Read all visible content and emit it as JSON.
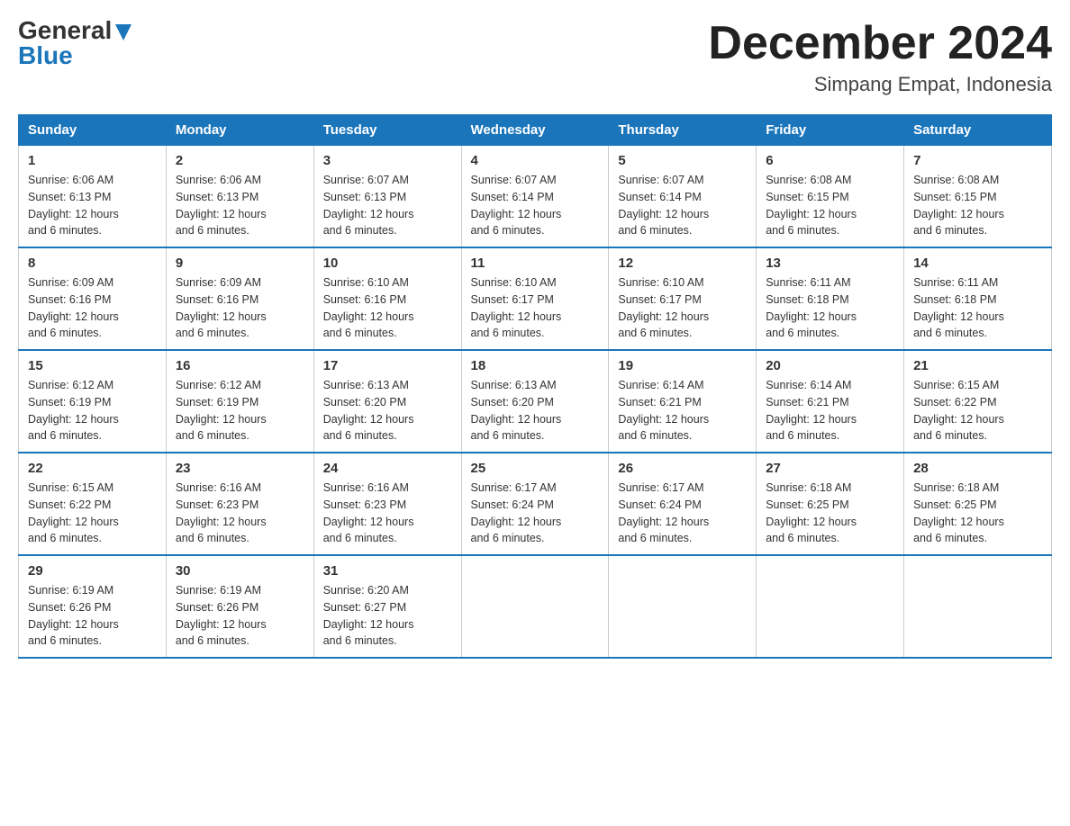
{
  "logo": {
    "general": "General",
    "blue": "Blue"
  },
  "header": {
    "month": "December 2024",
    "location": "Simpang Empat, Indonesia"
  },
  "days_of_week": [
    "Sunday",
    "Monday",
    "Tuesday",
    "Wednesday",
    "Thursday",
    "Friday",
    "Saturday"
  ],
  "weeks": [
    [
      {
        "day": "1",
        "sunrise": "6:06 AM",
        "sunset": "6:13 PM",
        "daylight": "12 hours and 6 minutes."
      },
      {
        "day": "2",
        "sunrise": "6:06 AM",
        "sunset": "6:13 PM",
        "daylight": "12 hours and 6 minutes."
      },
      {
        "day": "3",
        "sunrise": "6:07 AM",
        "sunset": "6:13 PM",
        "daylight": "12 hours and 6 minutes."
      },
      {
        "day": "4",
        "sunrise": "6:07 AM",
        "sunset": "6:14 PM",
        "daylight": "12 hours and 6 minutes."
      },
      {
        "day": "5",
        "sunrise": "6:07 AM",
        "sunset": "6:14 PM",
        "daylight": "12 hours and 6 minutes."
      },
      {
        "day": "6",
        "sunrise": "6:08 AM",
        "sunset": "6:15 PM",
        "daylight": "12 hours and 6 minutes."
      },
      {
        "day": "7",
        "sunrise": "6:08 AM",
        "sunset": "6:15 PM",
        "daylight": "12 hours and 6 minutes."
      }
    ],
    [
      {
        "day": "8",
        "sunrise": "6:09 AM",
        "sunset": "6:16 PM",
        "daylight": "12 hours and 6 minutes."
      },
      {
        "day": "9",
        "sunrise": "6:09 AM",
        "sunset": "6:16 PM",
        "daylight": "12 hours and 6 minutes."
      },
      {
        "day": "10",
        "sunrise": "6:10 AM",
        "sunset": "6:16 PM",
        "daylight": "12 hours and 6 minutes."
      },
      {
        "day": "11",
        "sunrise": "6:10 AM",
        "sunset": "6:17 PM",
        "daylight": "12 hours and 6 minutes."
      },
      {
        "day": "12",
        "sunrise": "6:10 AM",
        "sunset": "6:17 PM",
        "daylight": "12 hours and 6 minutes."
      },
      {
        "day": "13",
        "sunrise": "6:11 AM",
        "sunset": "6:18 PM",
        "daylight": "12 hours and 6 minutes."
      },
      {
        "day": "14",
        "sunrise": "6:11 AM",
        "sunset": "6:18 PM",
        "daylight": "12 hours and 6 minutes."
      }
    ],
    [
      {
        "day": "15",
        "sunrise": "6:12 AM",
        "sunset": "6:19 PM",
        "daylight": "12 hours and 6 minutes."
      },
      {
        "day": "16",
        "sunrise": "6:12 AM",
        "sunset": "6:19 PM",
        "daylight": "12 hours and 6 minutes."
      },
      {
        "day": "17",
        "sunrise": "6:13 AM",
        "sunset": "6:20 PM",
        "daylight": "12 hours and 6 minutes."
      },
      {
        "day": "18",
        "sunrise": "6:13 AM",
        "sunset": "6:20 PM",
        "daylight": "12 hours and 6 minutes."
      },
      {
        "day": "19",
        "sunrise": "6:14 AM",
        "sunset": "6:21 PM",
        "daylight": "12 hours and 6 minutes."
      },
      {
        "day": "20",
        "sunrise": "6:14 AM",
        "sunset": "6:21 PM",
        "daylight": "12 hours and 6 minutes."
      },
      {
        "day": "21",
        "sunrise": "6:15 AM",
        "sunset": "6:22 PM",
        "daylight": "12 hours and 6 minutes."
      }
    ],
    [
      {
        "day": "22",
        "sunrise": "6:15 AM",
        "sunset": "6:22 PM",
        "daylight": "12 hours and 6 minutes."
      },
      {
        "day": "23",
        "sunrise": "6:16 AM",
        "sunset": "6:23 PM",
        "daylight": "12 hours and 6 minutes."
      },
      {
        "day": "24",
        "sunrise": "6:16 AM",
        "sunset": "6:23 PM",
        "daylight": "12 hours and 6 minutes."
      },
      {
        "day": "25",
        "sunrise": "6:17 AM",
        "sunset": "6:24 PM",
        "daylight": "12 hours and 6 minutes."
      },
      {
        "day": "26",
        "sunrise": "6:17 AM",
        "sunset": "6:24 PM",
        "daylight": "12 hours and 6 minutes."
      },
      {
        "day": "27",
        "sunrise": "6:18 AM",
        "sunset": "6:25 PM",
        "daylight": "12 hours and 6 minutes."
      },
      {
        "day": "28",
        "sunrise": "6:18 AM",
        "sunset": "6:25 PM",
        "daylight": "12 hours and 6 minutes."
      }
    ],
    [
      {
        "day": "29",
        "sunrise": "6:19 AM",
        "sunset": "6:26 PM",
        "daylight": "12 hours and 6 minutes."
      },
      {
        "day": "30",
        "sunrise": "6:19 AM",
        "sunset": "6:26 PM",
        "daylight": "12 hours and 6 minutes."
      },
      {
        "day": "31",
        "sunrise": "6:20 AM",
        "sunset": "6:27 PM",
        "daylight": "12 hours and 6 minutes."
      },
      null,
      null,
      null,
      null
    ]
  ]
}
